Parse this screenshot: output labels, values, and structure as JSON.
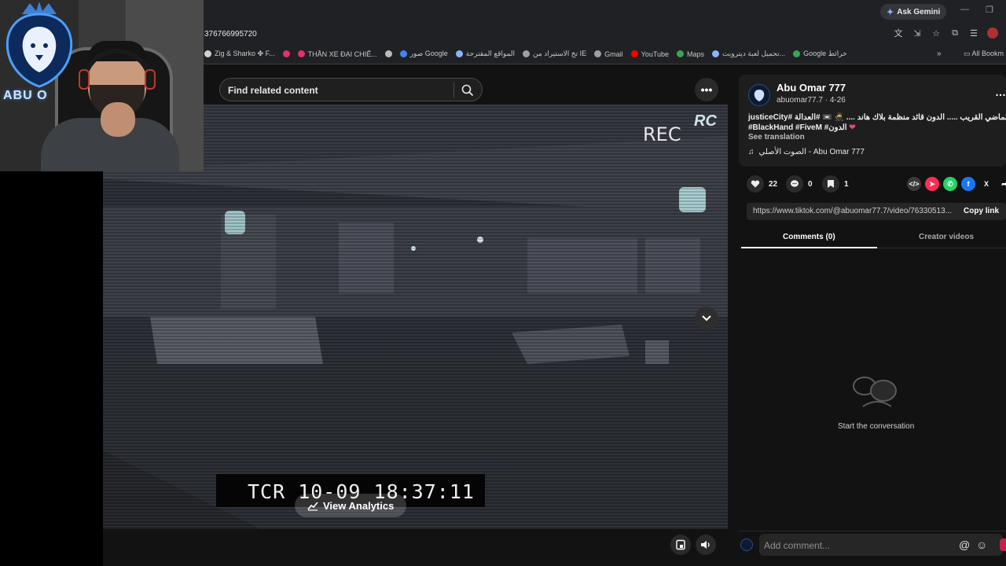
{
  "browser": {
    "ask_gemini": "Ask Gemini",
    "url": "376766995720",
    "bookmarks": [
      {
        "label": "Zig & Sharko ✤ F...",
        "color": "#d0d0d0"
      },
      {
        "label": "",
        "color": "#e1306c"
      },
      {
        "label": "THẦN XE ĐẠI CHIẾ...",
        "color": "#e1306c"
      },
      {
        "label": "",
        "color": "#bbbbbb"
      },
      {
        "label": "صور Google",
        "color": "#4285f4"
      },
      {
        "label": "المواقع المقترحة",
        "color": "#8ab4f8"
      },
      {
        "label": "تخ الاستيراد من IE",
        "color": "#9aa0a6"
      },
      {
        "label": "Gmail",
        "color": "#9aa0a6"
      },
      {
        "label": "YouTube",
        "color": "#ff0000"
      },
      {
        "label": "Maps",
        "color": "#34a853"
      },
      {
        "label": "تحميل لعبة ديترويت...",
        "color": "#8ab4f8"
      },
      {
        "label": "Google خرائط",
        "color": "#34a853"
      }
    ],
    "bookmarks_more": "»",
    "all_bookmarks": "All Bookm"
  },
  "webcam": {
    "logo_text": "ABU O"
  },
  "video": {
    "search_placeholder": "Find related content",
    "rec_label": "REC",
    "rc_logo": "RC",
    "timestamp": "TCR 10-09 18:37:11",
    "view_analytics": "View Analytics"
  },
  "author": {
    "name": "Abu Omar 777",
    "meta": "abuomar77.7 · 4-26",
    "desc_line1": "من الماضي القريب ..... الدون قائد منظمة بلاك هاند .... 🥷 📼 #العدالة #justiceCity",
    "desc_line2": "#BlackHand #FiveM #الدون",
    "see_translation": "See translation",
    "music": "الصوت الأصلي - Abu Omar 777"
  },
  "stats": {
    "likes": "22",
    "comments": "0",
    "saves": "1"
  },
  "share": {
    "link": "https://www.tiktok.com/@abuomar77.7/video/76330513...",
    "copy_link": "Copy link"
  },
  "tabs": {
    "comments": "Comments (0)",
    "creator_videos": "Creator videos"
  },
  "comments": {
    "empty_text": "Start the conversation",
    "placeholder": "Add comment...",
    "at": "@",
    "emoji": "☺"
  },
  "colors": {
    "accent": "#fe2c55",
    "panel_bg": "#1e1e1e",
    "page_bg": "#121212"
  }
}
